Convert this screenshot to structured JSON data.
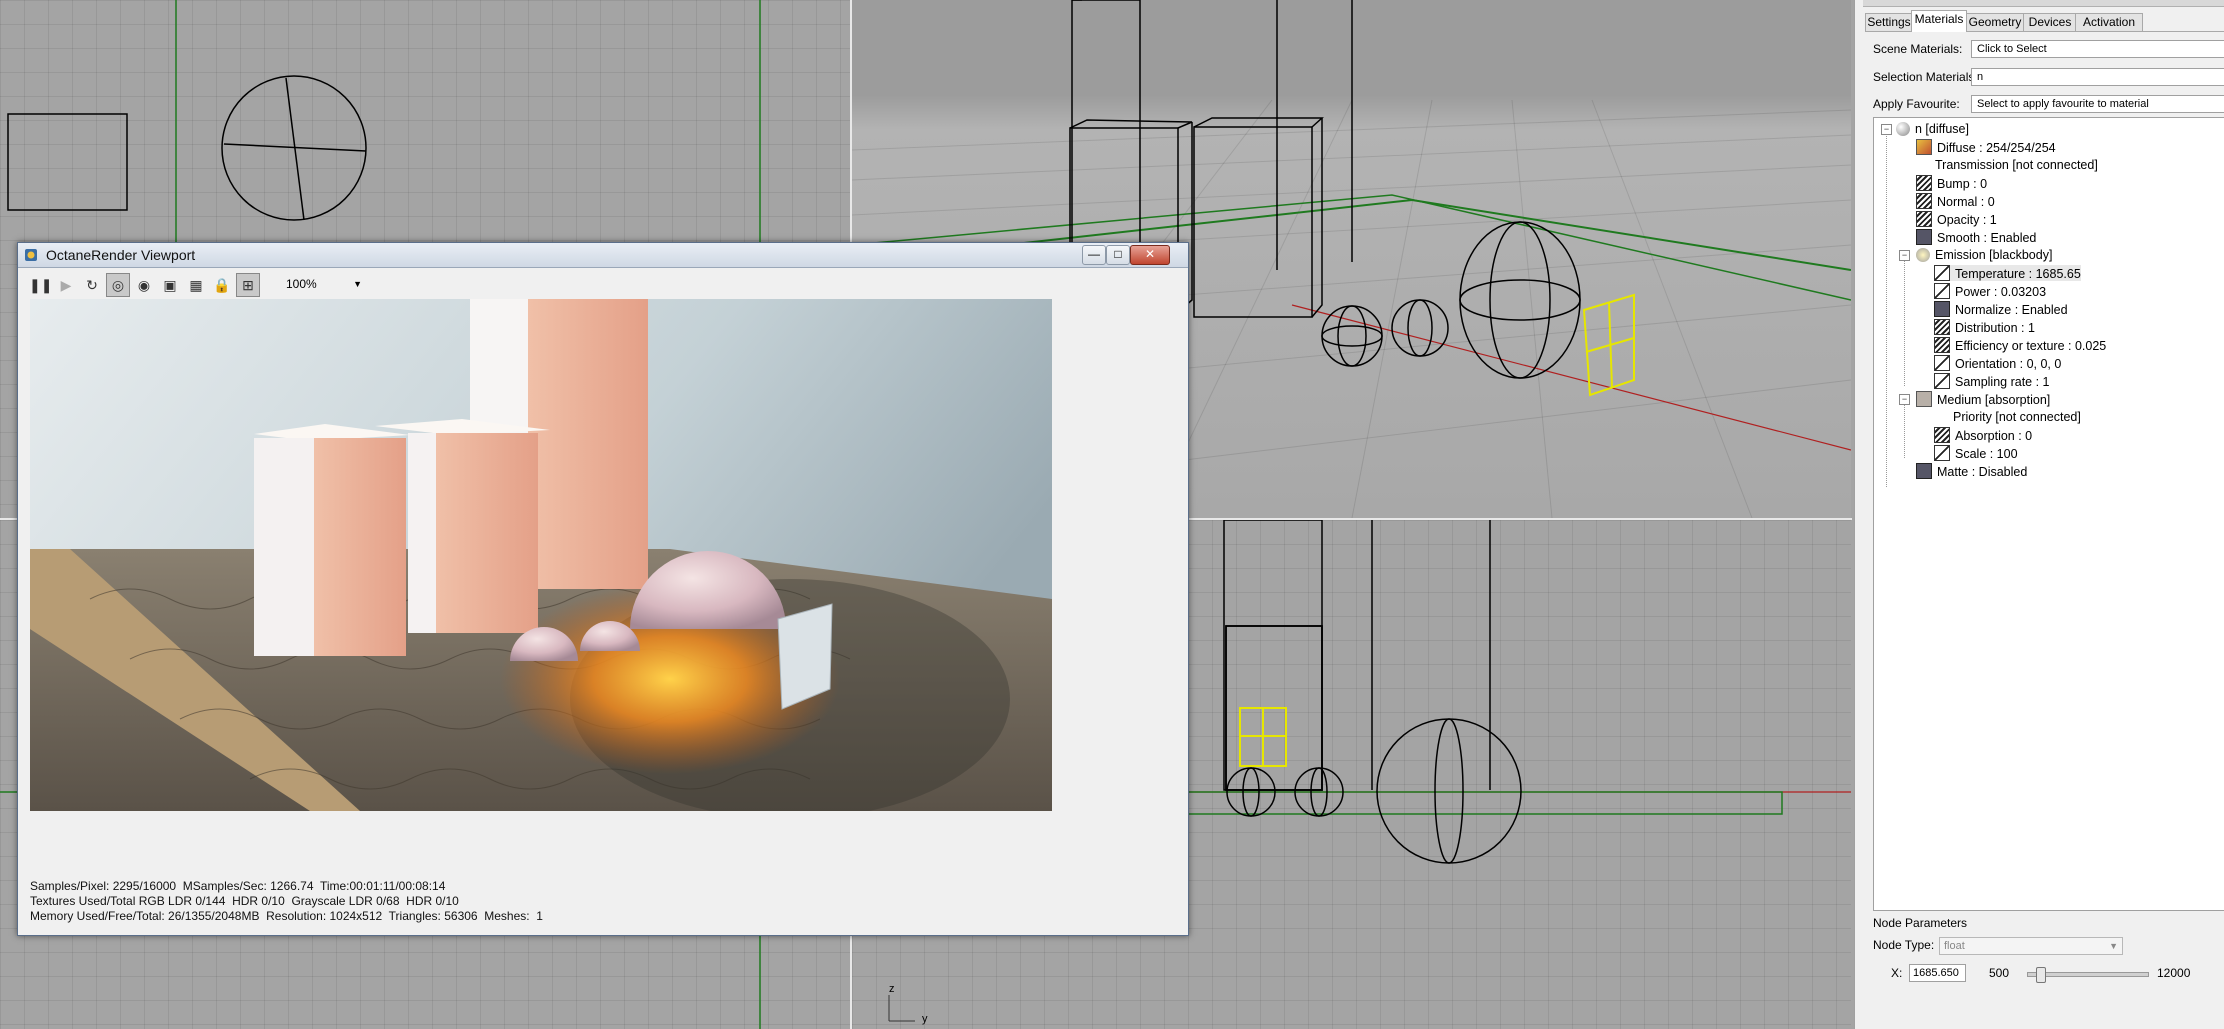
{
  "octane": {
    "title": "OctaneRender Viewport",
    "zoom": "100%",
    "toolbar_icons": [
      "pause-icon",
      "play-icon",
      "restart-icon",
      "focus-picker-icon",
      "material-picker-icon",
      "camera-icon",
      "region-icon",
      "lock-icon",
      "fit-icon"
    ],
    "status": [
      "Samples/Pixel: 2295/16000  MSamples/Sec: 1266.74  Time:00:01:11/00:08:14",
      "Textures Used/Total RGB LDR 0/144  HDR 0/10  Grayscale LDR 0/68  HDR 0/10",
      "Memory Used/Free/Total: 26/1355/2048MB  Resolution: 1024x512  Triangles: 56306  Meshes:  1"
    ]
  },
  "panel": {
    "tabs": [
      "Settings",
      "Materials",
      "Geometry",
      "Devices",
      "Activation"
    ],
    "active_tab": "Materials",
    "scene_materials_label": "Scene Materials:",
    "scene_materials_value": "Click to Select",
    "selection_materials_label": "Selection Materials:",
    "selection_materials_value": "n",
    "apply_favourite_label": "Apply Favourite:",
    "apply_favourite_value": "Select to apply favourite to material",
    "tree": [
      "n  [diffuse]",
      "Diffuse : 254/254/254",
      "Transmission  [not connected]",
      "Bump : 0",
      "Normal : 0",
      "Opacity : 1",
      "Smooth : Enabled",
      "Emission  [blackbody]",
      "Temperature : 1685.65",
      "Power : 0.03203",
      "Normalize : Enabled",
      "Distribution : 1",
      "Efficiency or texture : 0.025",
      "Orientation : 0, 0, 0",
      "Sampling rate : 1",
      "Medium  [absorption]",
      "Priority  [not connected]",
      "Absorption : 0",
      "Scale : 100",
      "Matte : Disabled"
    ],
    "node_params_title": "Node Parameters",
    "node_type_label": "Node Type:",
    "node_type_value": "float",
    "x_label": "X:",
    "x_value": "1685.650",
    "slider_min": "500",
    "slider_max": "12000",
    "slider_fraction": 0.103
  },
  "viewport": {
    "axis_z": "z",
    "axis_y": "y"
  },
  "colors": {
    "grid_green": "#1f7a1f",
    "axis_red": "#b02020",
    "selection_yellow": "#e6e600",
    "viewport_bg": "#a4a4a4"
  }
}
